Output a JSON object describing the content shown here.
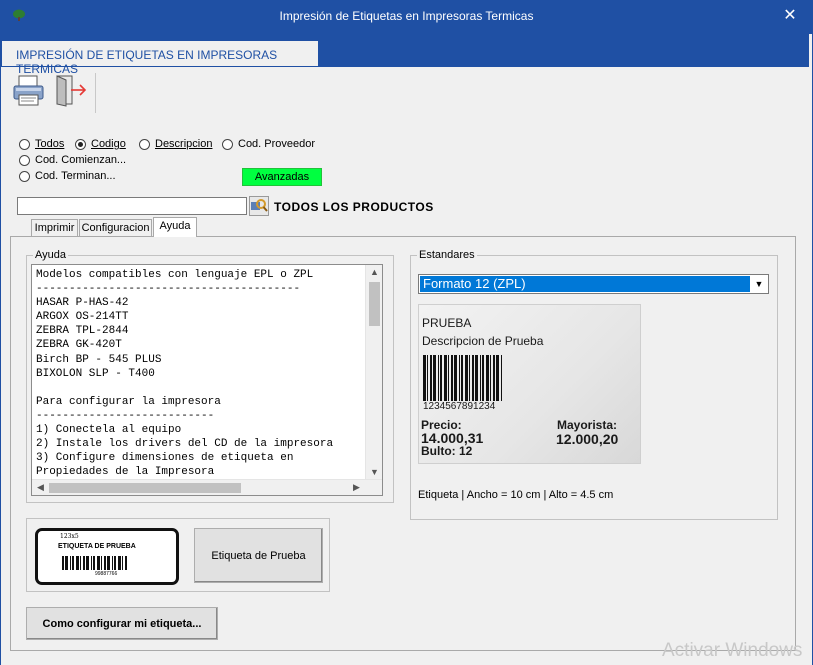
{
  "window": {
    "title": "Impresión de Etiquetas en Impresoras Termicas",
    "close_glyph": "✕"
  },
  "app_tab": {
    "label": "IMPRESIÓN DE ETIQUETAS EN IMPRESORAS TERMICAS"
  },
  "toolbar": {
    "print_icon": "printer-icon",
    "exit_icon": "exit-door-icon"
  },
  "filters": {
    "options": [
      {
        "label": "Todos",
        "selected": false
      },
      {
        "label": "Codigo",
        "selected": true
      },
      {
        "label": "Descripcion",
        "selected": false
      },
      {
        "label": "Cod. Proveedor",
        "selected": false
      },
      {
        "label": "Cod. Comienzan...",
        "selected": false
      },
      {
        "label": "Cod. Terminan...",
        "selected": false
      }
    ],
    "advanced_label": "Avanzadas"
  },
  "search": {
    "value": "",
    "button_icon": "search-icon",
    "results_label": "TODOS LOS PRODUCTOS"
  },
  "tabs": [
    {
      "label": "Imprimir",
      "active": false
    },
    {
      "label": "Configuracion",
      "active": false
    },
    {
      "label": "Ayuda",
      "active": true
    }
  ],
  "help": {
    "group_label": "Ayuda",
    "text": "Modelos compatibles con lenguaje EPL o ZPL\n----------------------------------------\nHASAR P-HAS-42\nARGOX OS-214TT\nZEBRA TPL-2844\nZEBRA GK-420T\nBirch BP - 545 PLUS\nBIXOLON SLP - T400\n\nPara configurar la impresora\n---------------------------\n1) Conectela al equipo\n2) Instale los drivers del CD de la impresora\n3) Configure dimensiones de etiqueta en\nPropiedades de la Impresora"
  },
  "standards": {
    "group_label": "Estandares",
    "selected": "Formato 12 (ZPL)",
    "preview": {
      "title": "PRUEBA",
      "description": "Descripcion de Prueba",
      "barcode_number": "1234567891234",
      "price_label": "Precio:",
      "price": "14.000,31",
      "wholesale_label": "Mayorista:",
      "wholesale_price": "12.000,20",
      "package": "Bulto: 12"
    },
    "dimensions_text": "Etiqueta | Ancho = 10 cm | Alto = 4.5 cm"
  },
  "test": {
    "label_code": "123x5",
    "label_title": "ETIQUETA DE PRUEBA",
    "label_barcode": "99887766",
    "button_label": "Etiqueta de Prueba"
  },
  "config_button": {
    "label": "Como configurar mi etiqueta..."
  },
  "watermark": {
    "text": "Activar Windows"
  }
}
